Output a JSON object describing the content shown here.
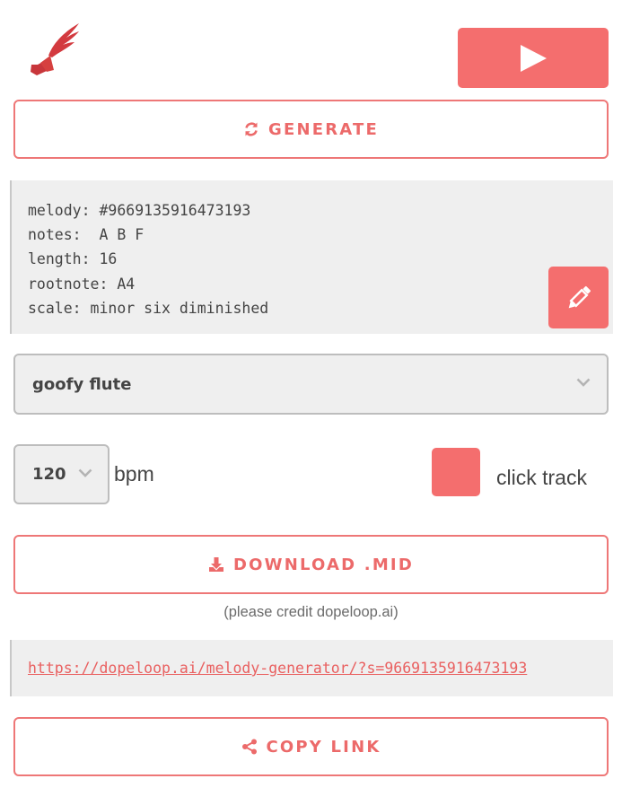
{
  "brand": {
    "logo_icon": "winged-note-logo",
    "accent": "#f46e6e"
  },
  "player": {
    "play_icon": "play-icon"
  },
  "generate": {
    "label": "GENERATE",
    "icon": "refresh-icon"
  },
  "melody_info": {
    "lines": [
      "melody: #9669135916473193",
      "notes:  A B F",
      "length: 16",
      "rootnote: A4",
      "scale: minor six diminished"
    ],
    "edit_icon": "pencil-icon"
  },
  "instrument": {
    "selected": "goofy flute"
  },
  "tempo": {
    "bpm_value": "120",
    "bpm_label": "bpm"
  },
  "click_track": {
    "label": "click track"
  },
  "download": {
    "label": "DOWNLOAD .MID",
    "icon": "download-icon",
    "credit": "(please credit dopeloop.ai)"
  },
  "share": {
    "link": "https://dopeloop.ai/melody-generator/?s=9669135916473193"
  },
  "copy": {
    "label": "COPY LINK",
    "icon": "share-icon"
  }
}
